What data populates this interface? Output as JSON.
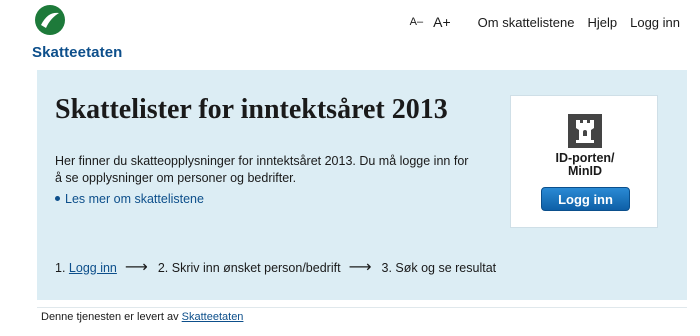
{
  "brand": {
    "name": "Skatteetaten",
    "color": "#0d4f8b",
    "mark_color": "#1d7a3a"
  },
  "topnav": {
    "font_smaller": "A–",
    "font_larger": "A+",
    "links": [
      "Om skattelistene",
      "Hjelp",
      "Logg inn"
    ]
  },
  "main": {
    "title": "Skattelister for inntektsåret 2013",
    "intro": "Her finner du skatteopplysninger for inntektsåret 2013. Du må logge inn for å se opplysninger om personer og bedrifter.",
    "read_more": "Les mer om skattelistene",
    "steps": {
      "step1_prefix": "1.",
      "step1_link": "Logg inn",
      "step2": "2. Skriv inn ønsket person/bedrift",
      "step3": "3. Søk og se resultat",
      "arrow": "⟶"
    },
    "panel_color": "#dcedf4"
  },
  "login_box": {
    "provider_line1": "ID-porten/",
    "provider_line2": "MinID",
    "provider_icon": "castle-tower-icon",
    "button_label": "Logg inn",
    "button_color": "#1b74be"
  },
  "footer": {
    "text": "Denne tjenesten er levert av",
    "link": "Skatteetaten"
  }
}
